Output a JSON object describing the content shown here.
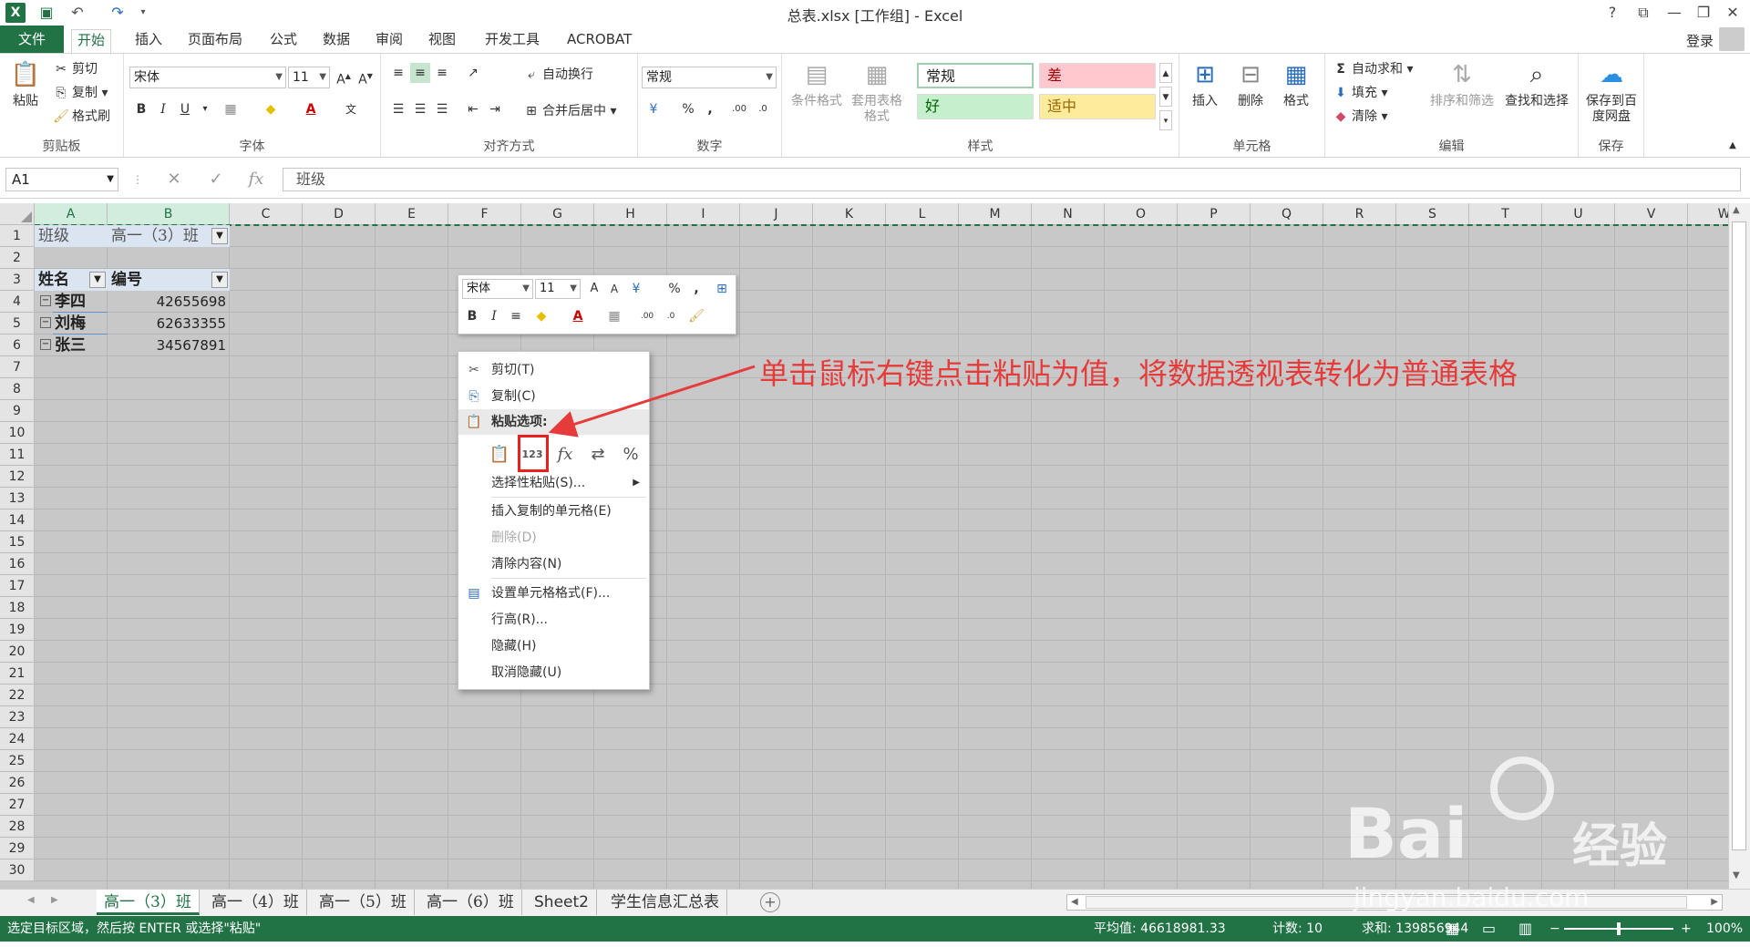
{
  "window": {
    "title": "总表.xlsx  [工作组] - Excel"
  },
  "tabs": [
    "文件",
    "开始",
    "插入",
    "页面布局",
    "公式",
    "数据",
    "审阅",
    "视图",
    "开发工具",
    "ACROBAT"
  ],
  "login": "登录",
  "ribbon": {
    "clipboard": {
      "label": "剪贴板",
      "paste": "粘贴",
      "cut": "剪切",
      "copy": "复制",
      "format_painter": "格式刷"
    },
    "font": {
      "label": "字体",
      "name": "宋体",
      "size": "11"
    },
    "alignment": {
      "label": "对齐方式",
      "wrap": "自动换行",
      "merge": "合并后居中"
    },
    "number": {
      "label": "数字",
      "format": "常规"
    },
    "styles": {
      "label": "样式",
      "conditional": "条件格式",
      "table": "套用表格格式",
      "normal": "常规",
      "bad": "差",
      "good": "好",
      "neutral": "适中"
    },
    "cells": {
      "label": "单元格",
      "insert": "插入",
      "delete": "删除",
      "format": "格式"
    },
    "editing": {
      "label": "编辑",
      "autosum": "自动求和",
      "fill": "填充",
      "clear": "清除",
      "sort": "排序和筛选",
      "find": "查找和选择"
    },
    "save": {
      "label": "保存",
      "btn": "保存到百度网盘"
    }
  },
  "formula_bar": {
    "namebox": "A1",
    "value": "班级"
  },
  "columns": [
    "A",
    "B",
    "C",
    "D",
    "E",
    "F",
    "G",
    "H",
    "I",
    "J",
    "K",
    "L",
    "M",
    "N",
    "O",
    "P",
    "Q",
    "R",
    "S",
    "T",
    "U",
    "V",
    "W"
  ],
  "rows": [
    "1",
    "2",
    "3",
    "4",
    "5",
    "6",
    "7",
    "8",
    "9",
    "10",
    "11",
    "12",
    "13",
    "14",
    "15",
    "16",
    "17",
    "18",
    "19",
    "20",
    "21",
    "22",
    "23",
    "24",
    "25",
    "26",
    "27",
    "28",
    "29",
    "30"
  ],
  "cells": {
    "a1": "班级",
    "b1": "高一（3）班",
    "a3": "姓名",
    "b3": "编号",
    "data": [
      {
        "name": "李四",
        "id": "42655698"
      },
      {
        "name": "刘梅",
        "id": "62633355"
      },
      {
        "name": "张三",
        "id": "34567891"
      }
    ]
  },
  "mini_toolbar": {
    "font": "宋体",
    "size": "11"
  },
  "context_menu": {
    "cut": "剪切(T)",
    "copy": "复制(C)",
    "paste_options": "粘贴选项:",
    "paste_special": "选择性粘贴(S)...",
    "insert_copied": "插入复制的单元格(E)",
    "delete": "删除(D)",
    "clear": "清除内容(N)",
    "format_cells": "设置单元格格式(F)...",
    "row_height": "行高(R)...",
    "hide": "隐藏(H)",
    "unhide": "取消隐藏(U)"
  },
  "annotation": "单击鼠标右键点击粘贴为值，将数据透视表转化为普通表格",
  "sheet_tabs": [
    "高一（3）班",
    "高一（4）班",
    "高一（5）班",
    "高一（6）班",
    "Sheet2",
    "学生信息汇总表"
  ],
  "status": {
    "message": "选定目标区域，然后按 ENTER 或选择\"粘贴\"",
    "average": "平均值: 46618981.33",
    "count": "计数: 10",
    "sum": "求和: 139856944",
    "zoom": "100%"
  },
  "watermark": {
    "brand": "Bai",
    "site": "jingyan.baidu.com",
    "suffix": "经验"
  },
  "colors": {
    "excel_green": "#217346",
    "annotation_red": "#e63b3b"
  }
}
